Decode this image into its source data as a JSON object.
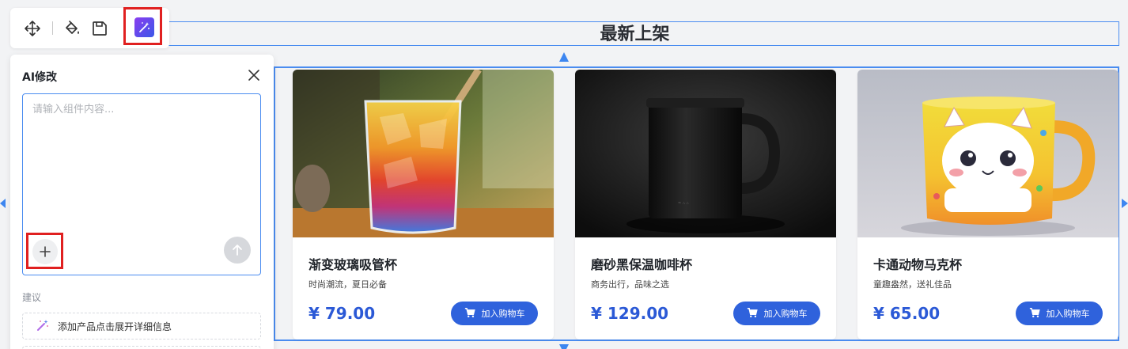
{
  "section": {
    "title": "最新上架"
  },
  "toolbar": {
    "icons": [
      "move-icon",
      "paint-bucket-icon",
      "save-icon",
      "magic-wand-icon"
    ]
  },
  "ai_panel": {
    "title": "AI修改",
    "placeholder": "请输入组件内容...",
    "input_value": "",
    "suggest_label": "建议",
    "suggestions": [
      {
        "label": "添加产品点击展开详细信息"
      }
    ]
  },
  "products": [
    {
      "name": "渐变玻璃吸管杯",
      "desc": "时尚潮流，夏日必备",
      "price": "¥ 79.00",
      "button": "加入购物车"
    },
    {
      "name": "磨砂黑保温咖啡杯",
      "desc": "商务出行，品味之选",
      "price": "¥ 129.00",
      "button": "加入购物车"
    },
    {
      "name": "卡通动物马克杯",
      "desc": "童趣盎然，送礼佳品",
      "price": "¥ 65.00",
      "button": "加入购物车"
    }
  ],
  "colors": {
    "accent": "#4a8cf0",
    "button": "#2f62dc",
    "price": "#2b59d6",
    "highlight": "#e02020"
  }
}
